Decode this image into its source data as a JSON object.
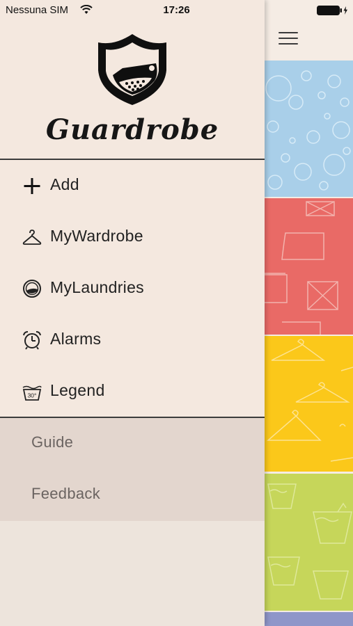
{
  "status_bar": {
    "carrier": "Nessuna SIM",
    "time": "17:26"
  },
  "drawer": {
    "app_title": "Guardrobe",
    "menu": [
      {
        "label": "Add",
        "icon": "plus-icon"
      },
      {
        "label": "MyWardrobe",
        "icon": "hanger-icon"
      },
      {
        "label": "MyLaundries",
        "icon": "washing-drum-icon"
      },
      {
        "label": "Alarms",
        "icon": "alarm-clock-icon"
      },
      {
        "label": "Legend",
        "icon": "wash-30-degrees-icon"
      }
    ],
    "secondary": [
      {
        "label": "Guide"
      },
      {
        "label": "Feedback"
      }
    ]
  },
  "main": {
    "menu_icon": "hamburger-menu-icon",
    "tiles": [
      {
        "name": "washing",
        "color": "#a9cfe9"
      },
      {
        "name": "ironing",
        "color": "#e96a66"
      },
      {
        "name": "wardrobe",
        "color": "#fbc81a"
      },
      {
        "name": "laundry",
        "color": "#c6d65a"
      },
      {
        "name": "more",
        "color": "#8f96c9"
      }
    ]
  },
  "colors": {
    "drawer_bg": "#f4e8df",
    "drawer_lower_bg": "#e3d6ce",
    "secondary_text": "#6b6461"
  }
}
